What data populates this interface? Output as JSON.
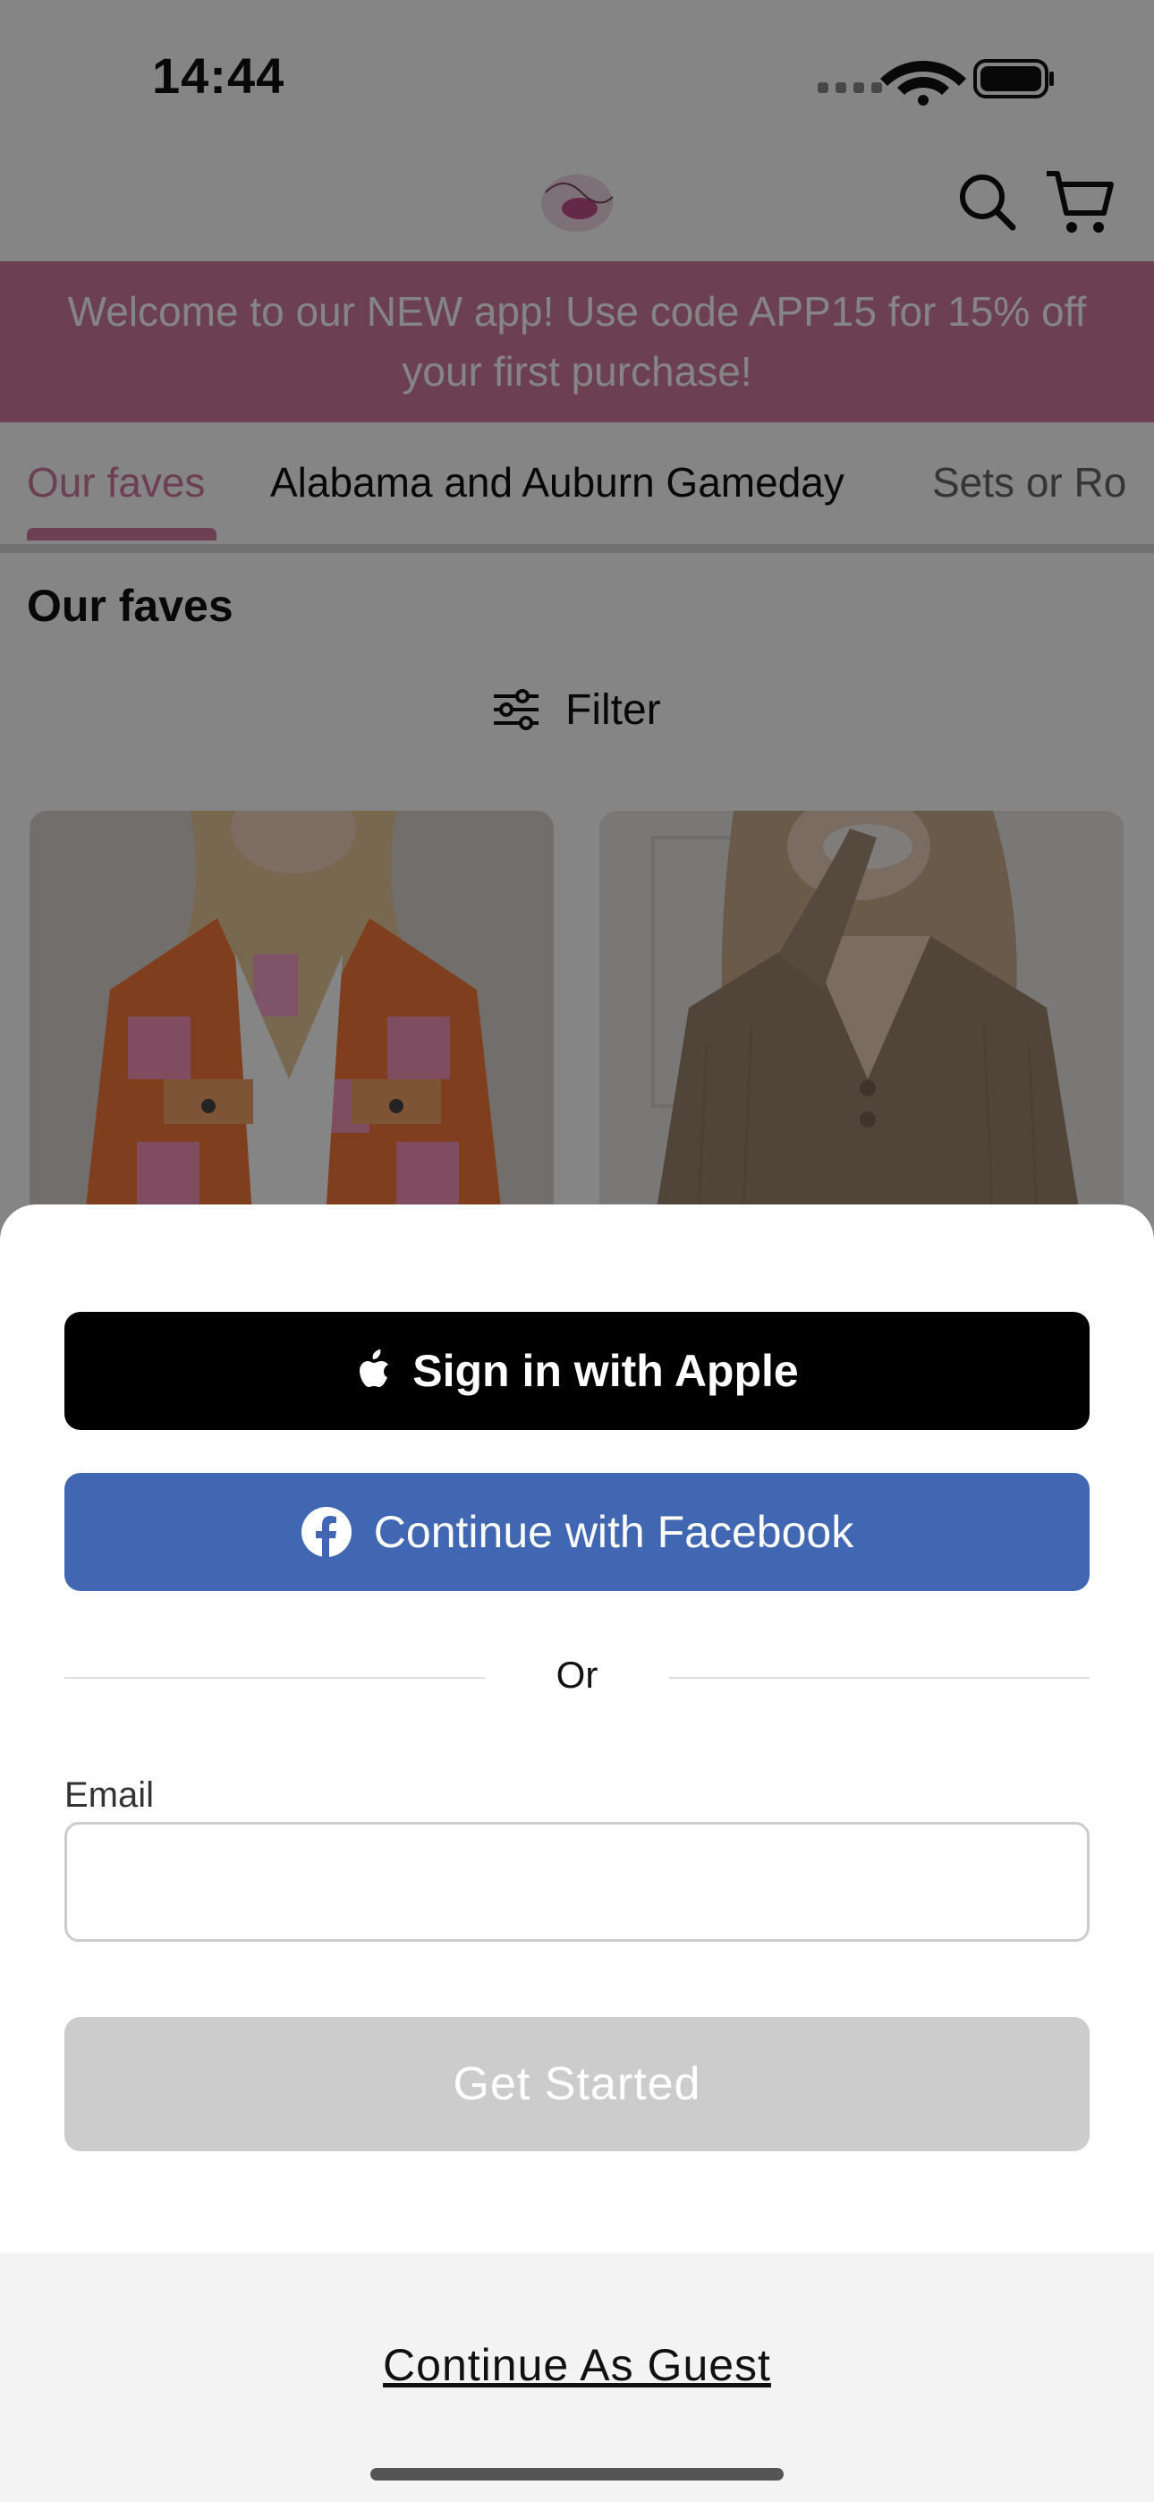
{
  "status_bar": {
    "time": "14:44"
  },
  "header": {
    "logo_icon": "brand-logo",
    "search_icon": "search-icon",
    "cart_icon": "cart-icon"
  },
  "promo_banner": {
    "text": "Welcome to our NEW app! Use code APP15 for 15% off your first purchase!"
  },
  "category_tabs": [
    {
      "label": "Our faves",
      "active": true
    },
    {
      "label": "Alabama and Auburn Gameday",
      "active": false
    },
    {
      "label": "Sets or Ro",
      "active": false
    }
  ],
  "section": {
    "title": "Our faves",
    "filter_label": "Filter"
  },
  "colors": {
    "accent": "#d07a9f",
    "facebook": "#4167b2",
    "apple": "#000000",
    "disabled": "#cccccc"
  },
  "sheet": {
    "apple_button": "Sign in with Apple",
    "facebook_button": "Continue with Facebook",
    "divider_text": "Or",
    "email_label": "Email",
    "email_value": "",
    "email_placeholder": "",
    "get_started": "Get Started",
    "guest_link": "Continue As Guest"
  }
}
